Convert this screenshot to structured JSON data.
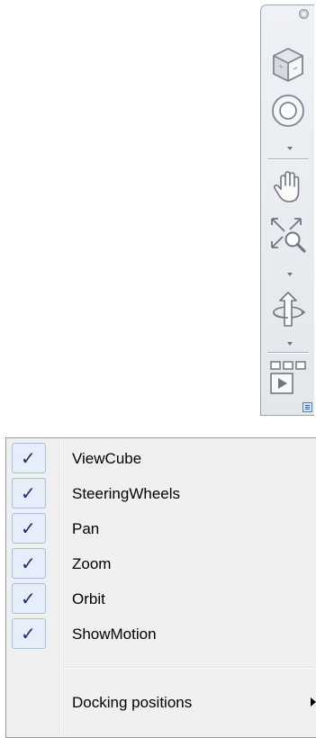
{
  "navbar": {
    "tools": [
      {
        "icon": "viewcube-icon"
      },
      {
        "icon": "steering-wheels-icon"
      },
      {
        "icon": "pan-hand-icon"
      },
      {
        "icon": "zoom-extents-icon"
      },
      {
        "icon": "orbit-icon"
      },
      {
        "icon": "showmotion-icon"
      }
    ]
  },
  "menu": {
    "items": [
      {
        "label": "ViewCube",
        "checked": true,
        "check": "✓"
      },
      {
        "label": "SteeringWheels",
        "checked": true,
        "check": "✓"
      },
      {
        "label": "Pan",
        "checked": true,
        "check": "✓"
      },
      {
        "label": "Zoom",
        "checked": true,
        "check": "✓"
      },
      {
        "label": "Orbit",
        "checked": true,
        "check": "✓"
      },
      {
        "label": "ShowMotion",
        "checked": true,
        "check": "✓"
      }
    ],
    "submenu": {
      "label": "Docking positions"
    }
  },
  "colors": {
    "check_bg": "#e5eef9",
    "check_border": "#a7bfdd",
    "menu_bg": "#f0f0f0",
    "toolbar_bg": "#e8ebef"
  }
}
